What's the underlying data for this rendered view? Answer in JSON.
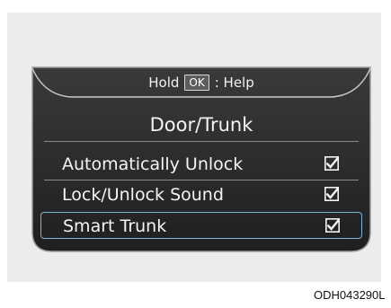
{
  "header": {
    "hold_label": "Hold",
    "ok_key": "OK",
    "help_label": ": Help"
  },
  "screen": {
    "title": "Door/Trunk"
  },
  "menu": {
    "items": [
      {
        "label": "Automatically Unlock",
        "checked": true,
        "selected": false
      },
      {
        "label": "Lock/Unlock Sound",
        "checked": true,
        "selected": false
      },
      {
        "label": "Smart Trunk",
        "checked": true,
        "selected": true
      }
    ]
  },
  "caption": "ODH043290L",
  "colors": {
    "screen_background": "#2a2a2a",
    "text": "#f4f4f4",
    "selection_border": "#7db4d8",
    "page_background": "#ececec"
  }
}
